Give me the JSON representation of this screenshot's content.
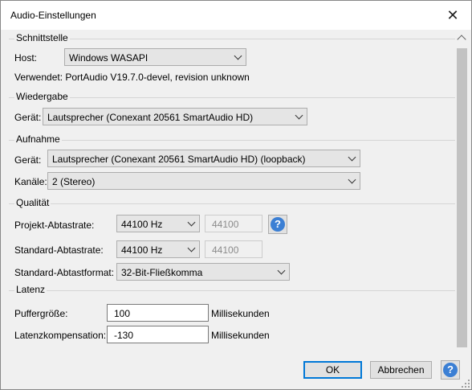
{
  "window": {
    "title": "Audio-Einstellungen",
    "close_glyph": "✕"
  },
  "schnittstelle": {
    "title": "Schnittstelle",
    "host_label": "Host:",
    "host_value": "Windows WASAPI",
    "verwendet": "Verwendet: PortAudio V19.7.0-devel, revision unknown"
  },
  "wiedergabe": {
    "title": "Wiedergabe",
    "geraet_label": "Gerät:",
    "geraet_value": "Lautsprecher (Conexant 20561 SmartAudio HD)"
  },
  "aufnahme": {
    "title": "Aufnahme",
    "geraet_label": "Gerät:",
    "geraet_value": "Lautsprecher (Conexant 20561 SmartAudio HD) (loopback)",
    "kanaele_label": "Kanäle:",
    "kanaele_value": "2 (Stereo)"
  },
  "qualitaet": {
    "title": "Qualität",
    "projekt_label": "Projekt-Abtastrate:",
    "projekt_value": "44100 Hz",
    "projekt_input": "44100",
    "standard_label": "Standard-Abtastrate:",
    "standard_value": "44100 Hz",
    "standard_input": "44100",
    "format_label": "Standard-Abtastformat:",
    "format_value": "32-Bit-Fließkomma"
  },
  "latenz": {
    "title": "Latenz",
    "puffer_label": "Puffergröße:",
    "puffer_value": "100",
    "puffer_unit": "Millisekunden",
    "komp_label": "Latenzkompensation:",
    "komp_value": "-130",
    "komp_unit": "Millisekunden"
  },
  "buttons": {
    "ok": "OK",
    "cancel": "Abbrechen",
    "help_glyph": "?"
  },
  "colors": {
    "accent": "#0078d7",
    "help_icon": "#3b7fd4"
  }
}
